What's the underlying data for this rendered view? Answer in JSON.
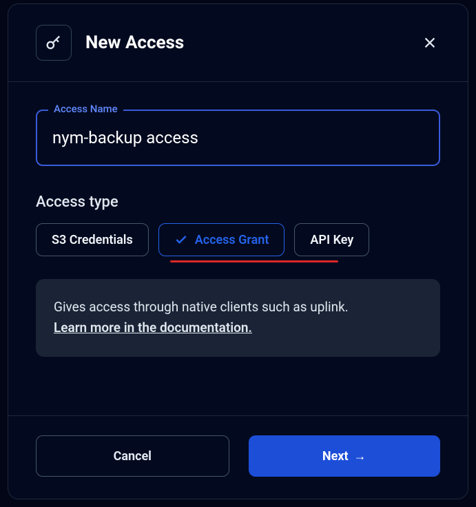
{
  "modal": {
    "title": "New Access",
    "accessName": {
      "label": "Access Name",
      "value": "nym-backup access"
    },
    "accessType": {
      "label": "Access type",
      "options": [
        {
          "label": "S3 Credentials",
          "selected": false
        },
        {
          "label": "Access Grant",
          "selected": true
        },
        {
          "label": "API Key",
          "selected": false
        }
      ]
    },
    "infoBox": {
      "text": "Gives access through native clients such as uplink.",
      "linkText": "Learn more in the documentation."
    },
    "footer": {
      "cancel": "Cancel",
      "next": "Next"
    }
  }
}
